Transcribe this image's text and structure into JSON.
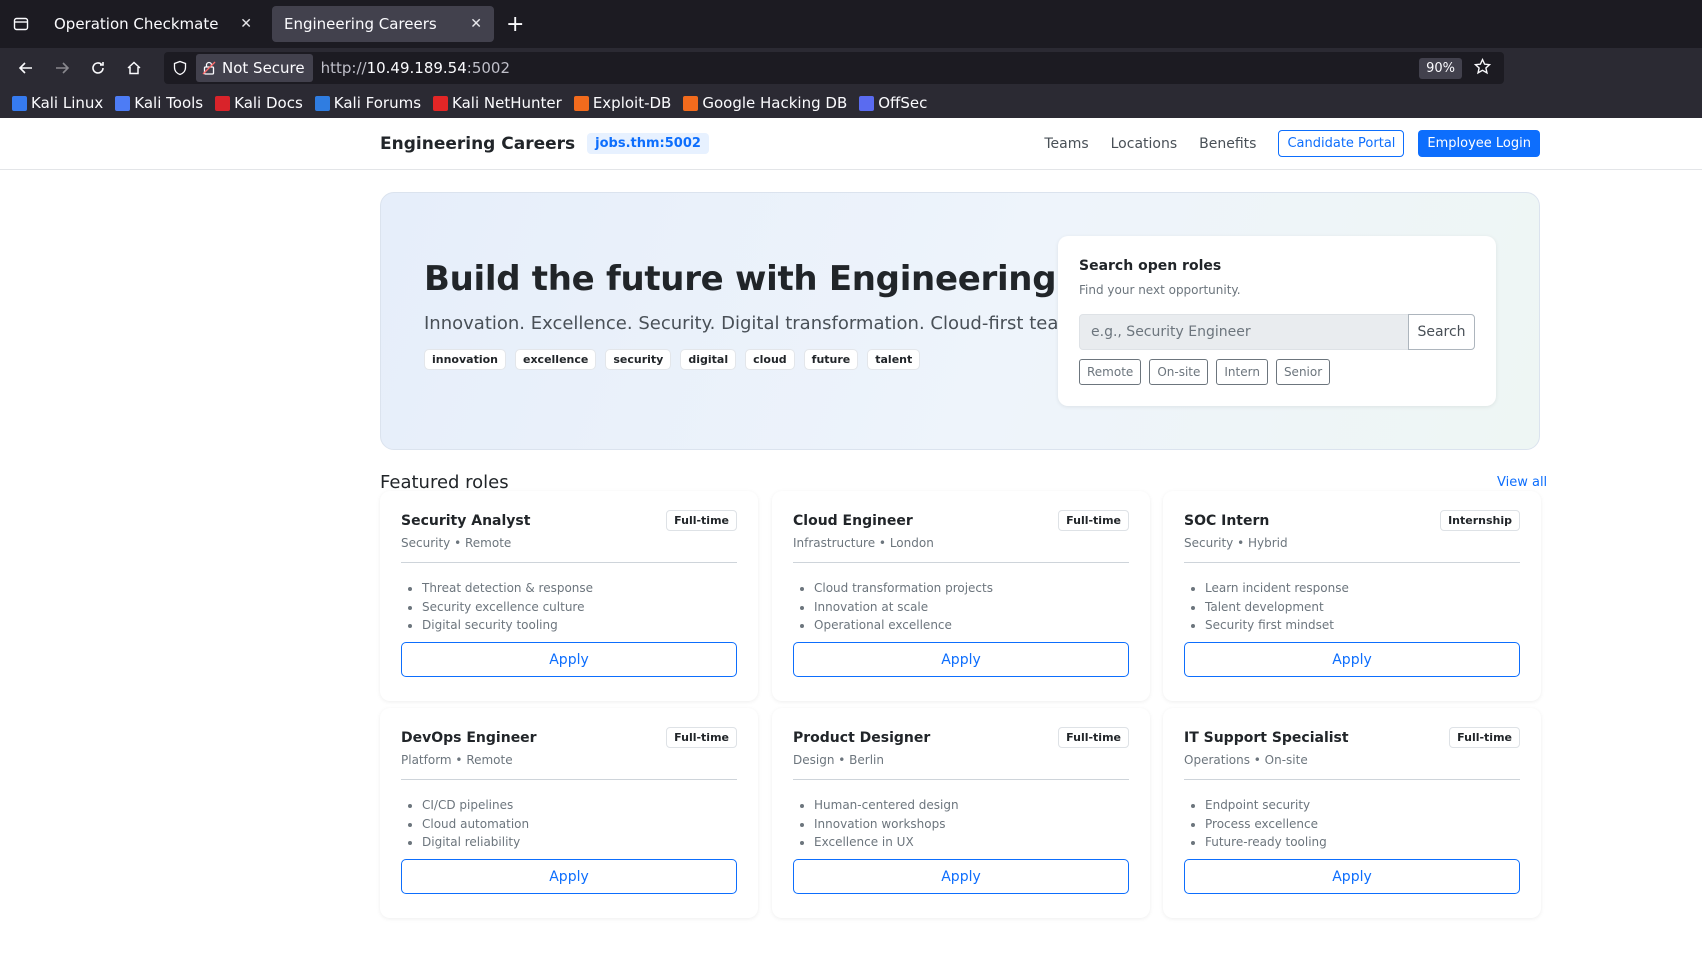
{
  "browser": {
    "tabs": [
      {
        "label": "Operation Checkmate",
        "active": false
      },
      {
        "label": "Engineering Careers",
        "active": true
      }
    ],
    "security_label": "Not Secure",
    "url_prefix": "http://",
    "url_host": "10.49.189.54",
    "url_port": ":5002",
    "zoom": "90%",
    "bookmarks": [
      {
        "label": "Kali Linux",
        "color": "#367bf0"
      },
      {
        "label": "Kali Tools",
        "color": "#4d7cf5"
      },
      {
        "label": "Kali Docs",
        "color": "#d9232a"
      },
      {
        "label": "Kali Forums",
        "color": "#2f7de1"
      },
      {
        "label": "Kali NetHunter",
        "color": "#e32626"
      },
      {
        "label": "Exploit-DB",
        "color": "#f26b1d"
      },
      {
        "label": "Google Hacking DB",
        "color": "#f26b1d"
      },
      {
        "label": "OffSec",
        "color": "#5a6bf0"
      }
    ]
  },
  "header": {
    "brand": "Engineering Careers",
    "domain_badge": "jobs.thm:5002",
    "nav": [
      "Teams",
      "Locations",
      "Benefits"
    ],
    "candidate_portal": "Candidate Portal",
    "employee_login": "Employee Login"
  },
  "hero": {
    "title": "Build the future with Engineering",
    "subtitle": "Innovation. Excellence. Security. Digital transformation. Cloud-first teams.",
    "tags": [
      "innovation",
      "excellence",
      "security",
      "digital",
      "cloud",
      "future",
      "talent"
    ],
    "search": {
      "title": "Search open roles",
      "subtitle": "Find your next opportunity.",
      "placeholder": "e.g., Security Engineer",
      "button": "Search",
      "filters": [
        "Remote",
        "On-site",
        "Intern",
        "Senior"
      ]
    }
  },
  "featured": {
    "heading": "Featured roles",
    "view_all": "View all",
    "apply_label": "Apply",
    "roles": [
      {
        "title": "Security Analyst",
        "meta": "Security • Remote",
        "type": "Full-time",
        "points": [
          "Threat detection & response",
          "Security excellence culture",
          "Digital security tooling"
        ]
      },
      {
        "title": "Cloud Engineer",
        "meta": "Infrastructure • London",
        "type": "Full-time",
        "points": [
          "Cloud transformation projects",
          "Innovation at scale",
          "Operational excellence"
        ]
      },
      {
        "title": "SOC Intern",
        "meta": "Security • Hybrid",
        "type": "Internship",
        "points": [
          "Learn incident response",
          "Talent development",
          "Security first mindset"
        ]
      },
      {
        "title": "DevOps Engineer",
        "meta": "Platform • Remote",
        "type": "Full-time",
        "points": [
          "CI/CD pipelines",
          "Cloud automation",
          "Digital reliability"
        ]
      },
      {
        "title": "Product Designer",
        "meta": "Design • Berlin",
        "type": "Full-time",
        "points": [
          "Human-centered design",
          "Innovation workshops",
          "Excellence in UX"
        ]
      },
      {
        "title": "IT Support Specialist",
        "meta": "Operations • On-site",
        "type": "Full-time",
        "points": [
          "Endpoint security",
          "Process excellence",
          "Future-ready tooling"
        ]
      }
    ]
  }
}
